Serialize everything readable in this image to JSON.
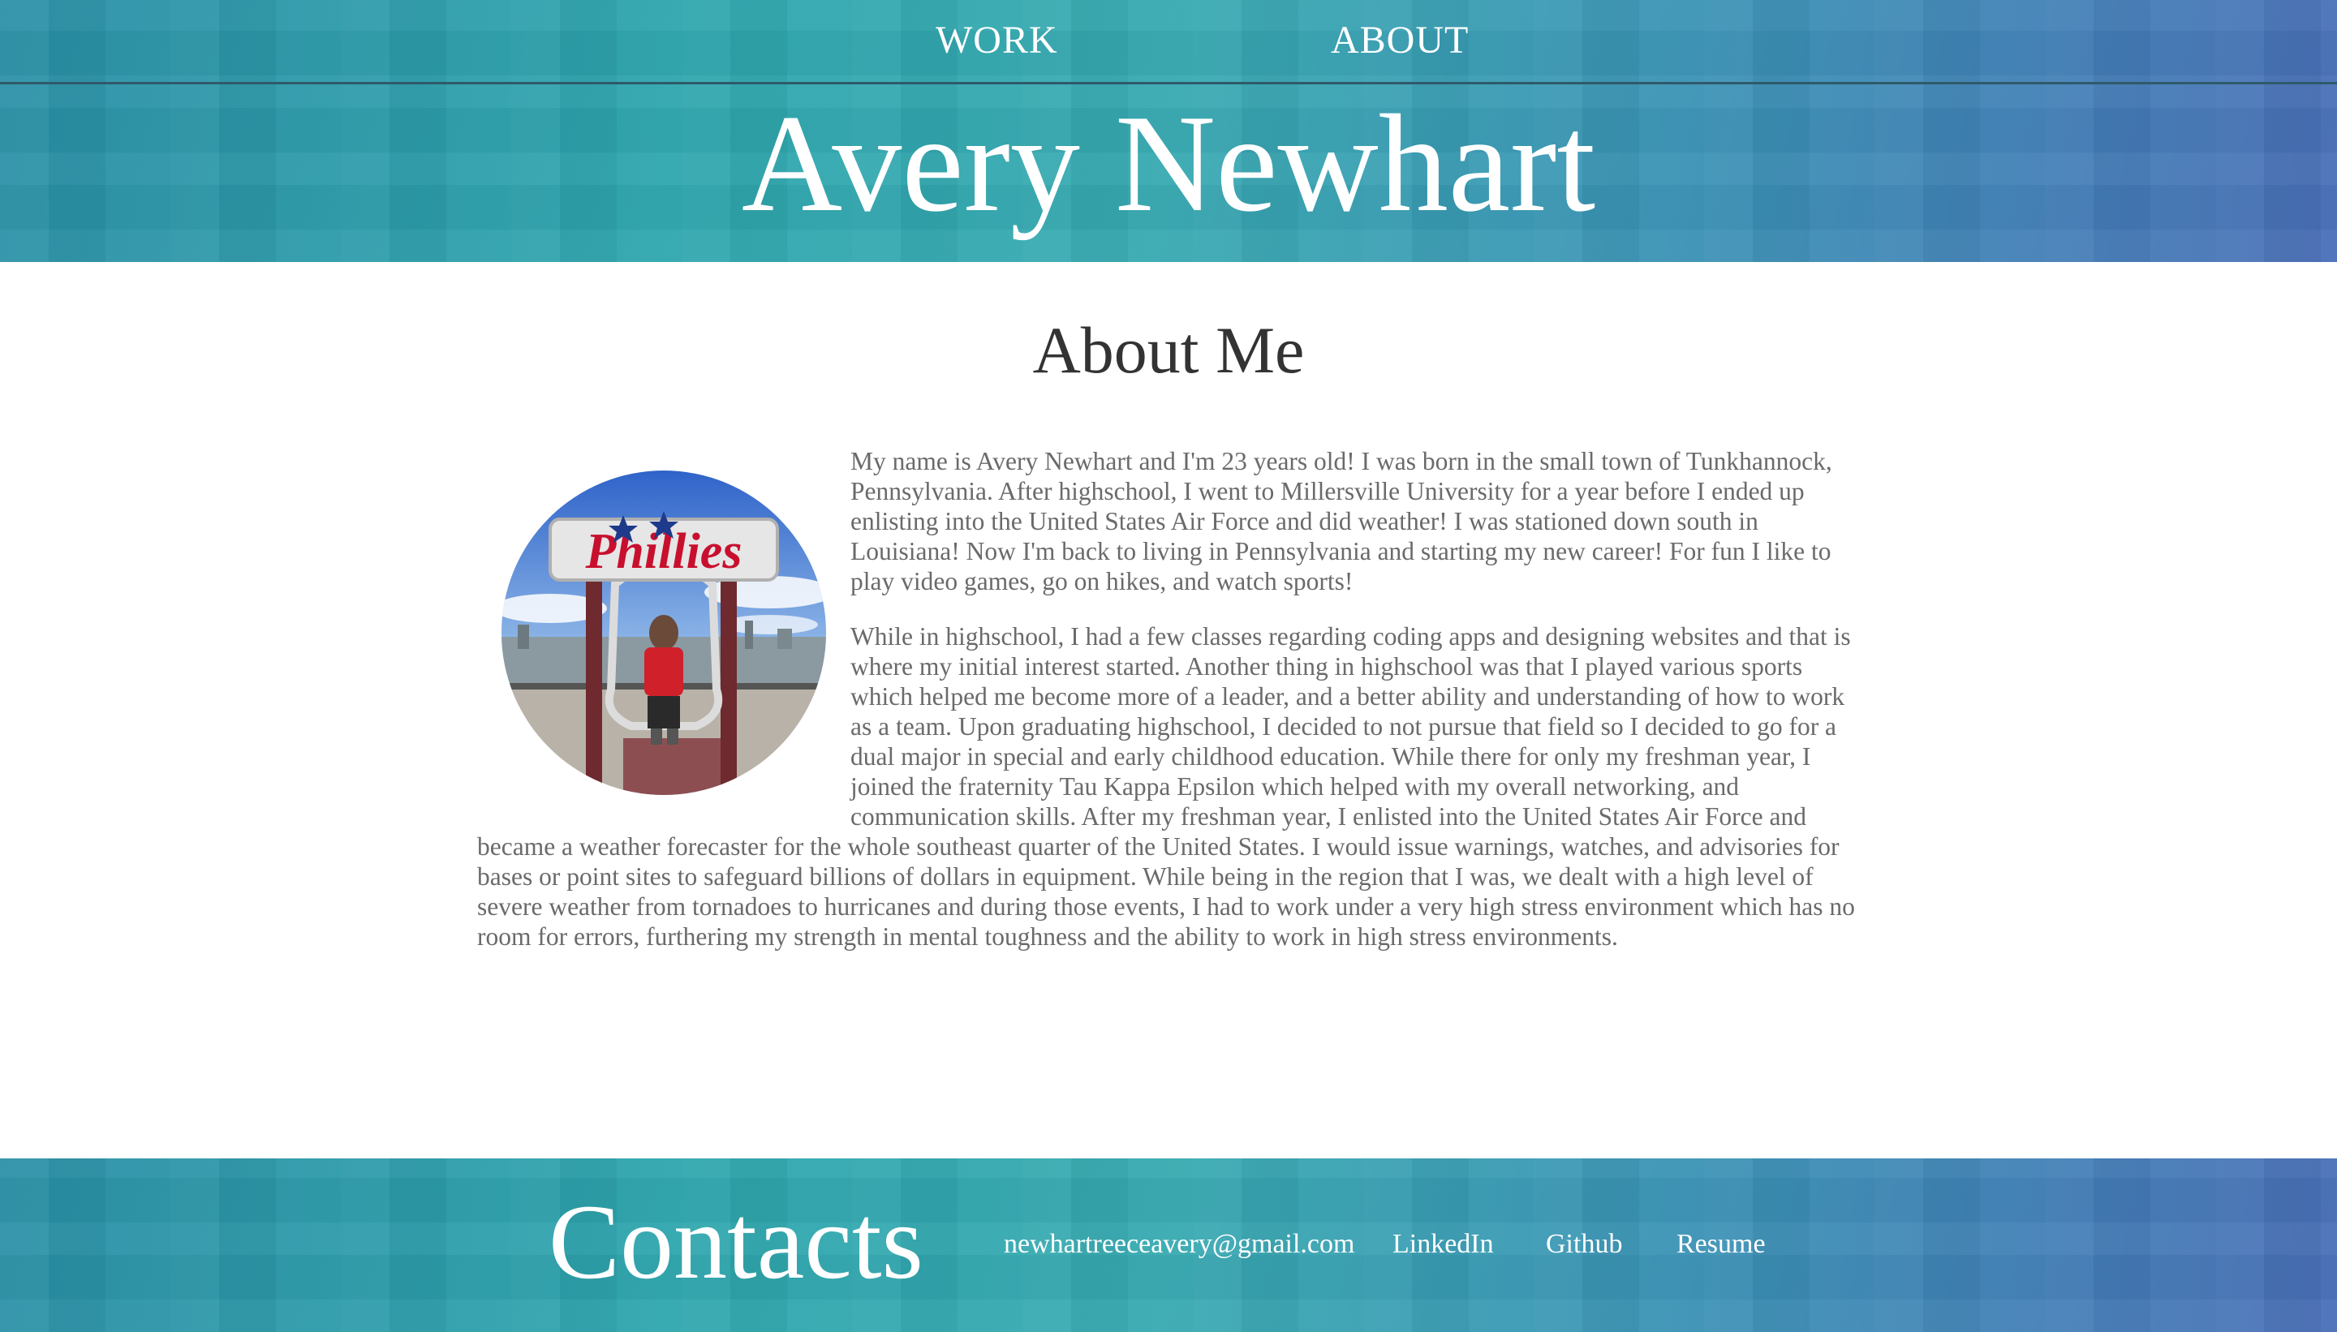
{
  "nav": {
    "work_label": "WORK",
    "about_label": "ABOUT"
  },
  "header": {
    "title": "Avery Newhart"
  },
  "about": {
    "heading": "About Me",
    "paragraphs": [
      "My name is Avery Newhart and I'm 23 years old! I was born in the small town of Tunkhannock, Pennsylvania. After highschool, I went to Millersville University for a year before I ended up enlisting into the United States Air Force and did weather! I was stationed down south in Louisiana! Now I'm back to living in Pennsylvania and starting my new career! For fun I like to play video games, go on hikes, and watch sports!",
      "While in highschool, I had a few classes regarding coding apps and designing websites and that is where my initial interest started. Another thing in highschool was that I played various sports which helped me become more of a leader, and a better ability and understanding of how to work as a team. Upon graduating highschool, I decided to not pursue that field so I decided to go for a dual major in special and early childhood education. While there for only my freshman year, I joined the fraternity Tau Kappa Epsilon which helped with my overall networking, and communication skills. After my freshman year, I enlisted into the United States Air Force and became a weather forecaster for the whole southeast quarter of the United States. I would issue warnings, watches, and advisories for bases or point sites to safeguard billions of dollars in equipment. While being in the region that I was, we dealt with a high level of severe weather from tornadoes to hurricanes and during those events, I had to work under a very high stress environment which has no room for errors, furthering my strength in mental toughness and the ability to work in high stress environments."
    ],
    "photo_sign_text": "Phillies"
  },
  "footer": {
    "title": "Contacts",
    "email": "newhartreeceavery@gmail.com",
    "linkedin": "LinkedIn",
    "github": "Github",
    "resume": "Resume"
  },
  "colors": {
    "accent_teal": "#2ea6ad",
    "accent_blue": "#4a6fb8",
    "heading_text": "#333333",
    "body_text": "#6a6a6a"
  }
}
